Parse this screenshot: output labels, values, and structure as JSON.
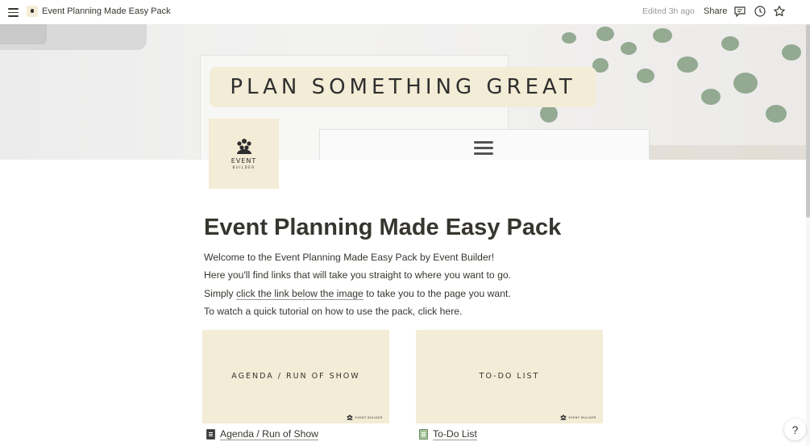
{
  "topbar": {
    "breadcrumb": "Event Planning Made Easy Pack",
    "edited": "Edited 3h ago",
    "share_label": "Share",
    "icons": [
      "menu-icon",
      "comment-icon",
      "history-icon",
      "star-icon"
    ]
  },
  "cover": {
    "banner_text": "PLAN SOMETHING GREAT"
  },
  "page_icon": {
    "logo_text": "EVENT",
    "logo_sub": "BUILDER"
  },
  "page": {
    "title": "Event Planning Made Easy Pack",
    "lines": [
      "Welcome to the Event Planning Made Easy Pack by Event Builder!",
      "Here you'll find links that will take you straight to where you want to go."
    ],
    "line3_prefix": "Simply ",
    "line3_link": "click the link below the image",
    "line3_suffix": " to take you to the page you want.",
    "line4": "To watch a quick tutorial on how to use the pack, click here."
  },
  "cards": [
    {
      "title": "AGENDA / RUN OF SHOW",
      "logo": "EVENT BUILDER",
      "link": "Agenda / Run of Show"
    },
    {
      "title": "TO-DO LIST",
      "logo": "EVENT BUILDER",
      "link": "To-Do List"
    }
  ],
  "help_label": "?",
  "colors": {
    "card_bg": "#f3ecd6",
    "text": "#37352f",
    "muted": "#9b9a97"
  }
}
